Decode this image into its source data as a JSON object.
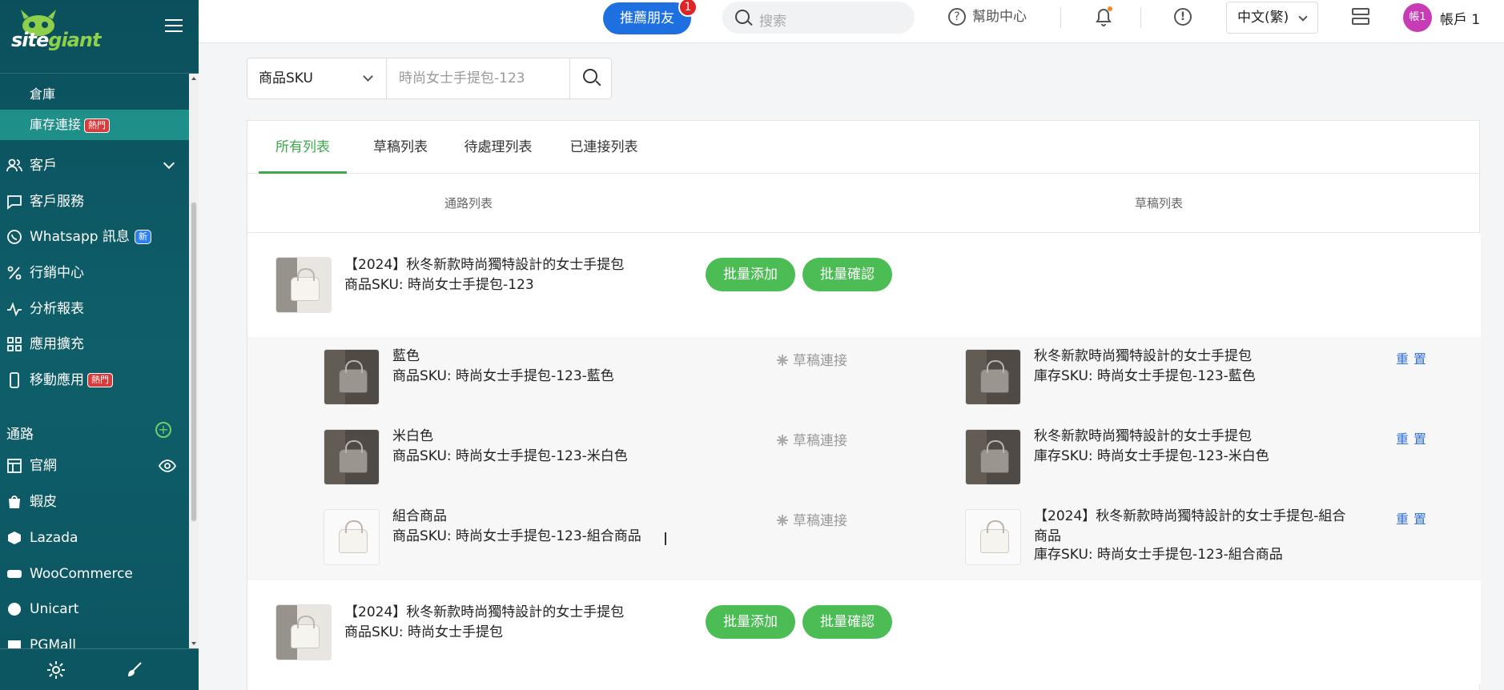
{
  "sidebar": {
    "logo_text_a": "site",
    "logo_text_b": "giant",
    "sub_items": [
      {
        "label": "倉庫",
        "badge": ""
      },
      {
        "label": "庫存連接",
        "badge": "熱門"
      }
    ],
    "nav_items": [
      {
        "label": "客戶",
        "icon": "users-icon",
        "caret": true
      },
      {
        "label": "客戶服務",
        "icon": "chat-icon"
      },
      {
        "label": "Whatsapp 訊息",
        "icon": "whatsapp-icon",
        "badge": "新"
      },
      {
        "label": "行銷中心",
        "icon": "percent-icon"
      },
      {
        "label": "分析報表",
        "icon": "activity-icon"
      },
      {
        "label": "應用擴充",
        "icon": "grid-icon"
      },
      {
        "label": "移動應用",
        "icon": "mobile-icon",
        "badge": "熱門"
      }
    ],
    "section_label": "通路",
    "channels": [
      {
        "label": "官網",
        "icon": "layout-icon"
      },
      {
        "label": "蝦皮",
        "icon": "shopee-icon"
      },
      {
        "label": "Lazada",
        "icon": "lazada-icon"
      },
      {
        "label": "WooCommerce",
        "icon": "woo-icon"
      },
      {
        "label": "Unicart",
        "icon": "unicart-icon"
      },
      {
        "label": "PGMall",
        "icon": "pgmall-icon"
      }
    ]
  },
  "topbar": {
    "recommend_label": "推薦朋友",
    "recommend_badge": "1",
    "search_placeholder": "搜索",
    "help_label": "幫助中心",
    "language": "中文(繁)",
    "avatar_text": "帳1",
    "account_label": "帳戶 1"
  },
  "filter": {
    "field": "商品SKU",
    "value": "時尚女士手提包-123"
  },
  "tabs": [
    "所有列表",
    "草稿列表",
    "待處理列表",
    "已連接列表"
  ],
  "columns": {
    "left": "通路列表",
    "right": "草稿列表"
  },
  "buttons": {
    "batch_add": "批量添加",
    "batch_confirm": "批量確認"
  },
  "groups": [
    {
      "title": "【2024】秋冬新款時尚獨特設計的女士手提包",
      "sku": "商品SKU: 時尚女士手提包-123"
    },
    {
      "title": "【2024】秋冬新款時尚獨特設計的女士手提包",
      "sku": "商品SKU: 時尚女士手提包"
    }
  ],
  "draft_link_label": "草稿連接",
  "reset_label": "重置",
  "variants": [
    {
      "name": "藍色",
      "sku": "商品SKU: 時尚女士手提包-123-藍色",
      "draft_title": "秋冬新款時尚獨特設計的女士手提包",
      "draft_title2": "",
      "draft_sku": "庫存SKU: 時尚女士手提包-123-藍色"
    },
    {
      "name": "米白色",
      "sku": "商品SKU: 時尚女士手提包-123-米白色",
      "draft_title": "秋冬新款時尚獨特設計的女士手提包",
      "draft_title2": "",
      "draft_sku": "庫存SKU: 時尚女士手提包-123-米白色"
    },
    {
      "name": "組合商品",
      "sku": "商品SKU: 時尚女士手提包-123-組合商品",
      "draft_title": "【2024】秋冬新款時尚獨特設計的女士手提包-組合",
      "draft_title2": "商品",
      "draft_sku": "庫存SKU: 時尚女士手提包-123-組合商品"
    }
  ],
  "colors": {
    "accent_green": "#4cbc54",
    "sidebar_bg": "#0e5f6a",
    "link_blue": "#2f6fd6"
  }
}
